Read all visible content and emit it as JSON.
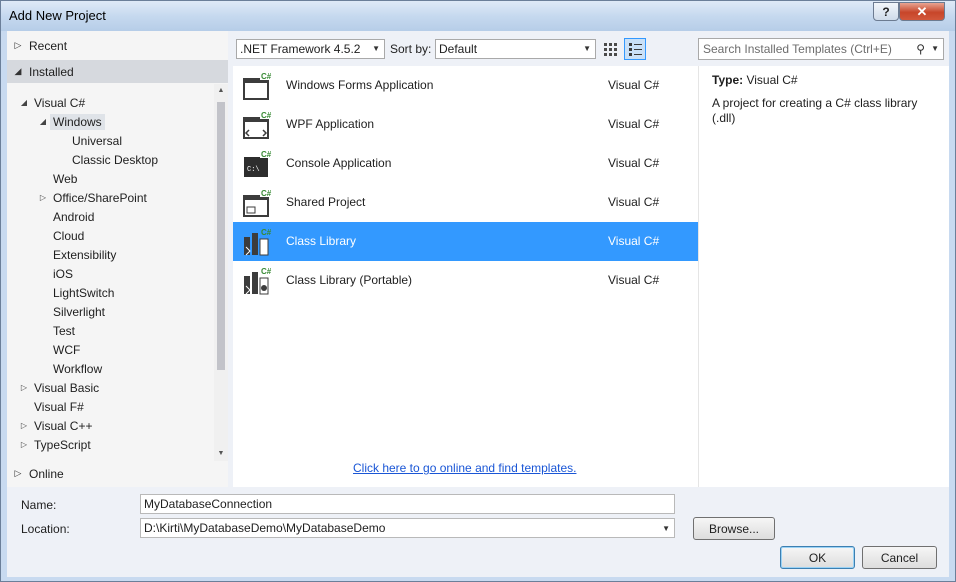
{
  "window": {
    "title": "Add New Project",
    "help_label": "?",
    "close_label": "✕"
  },
  "left": {
    "recent": "Recent",
    "installed": "Installed",
    "online": "Online",
    "tree": [
      {
        "label": "Visual C#",
        "arrow": "◢",
        "indent": 0
      },
      {
        "label": "Windows",
        "arrow": "◢",
        "indent": 1,
        "selected": true
      },
      {
        "label": "Universal",
        "arrow": "",
        "indent": 2
      },
      {
        "label": "Classic Desktop",
        "arrow": "",
        "indent": 2
      },
      {
        "label": "Web",
        "arrow": "",
        "indent": 1
      },
      {
        "label": "Office/SharePoint",
        "arrow": "▷",
        "indent": 1
      },
      {
        "label": "Android",
        "arrow": "",
        "indent": 1
      },
      {
        "label": "Cloud",
        "arrow": "",
        "indent": 1
      },
      {
        "label": "Extensibility",
        "arrow": "",
        "indent": 1
      },
      {
        "label": "iOS",
        "arrow": "",
        "indent": 1
      },
      {
        "label": "LightSwitch",
        "arrow": "",
        "indent": 1
      },
      {
        "label": "Silverlight",
        "arrow": "",
        "indent": 1
      },
      {
        "label": "Test",
        "arrow": "",
        "indent": 1
      },
      {
        "label": "WCF",
        "arrow": "",
        "indent": 1
      },
      {
        "label": "Workflow",
        "arrow": "",
        "indent": 1
      },
      {
        "label": "Visual Basic",
        "arrow": "▷",
        "indent": 0
      },
      {
        "label": "Visual F#",
        "arrow": "",
        "indent": 0
      },
      {
        "label": "Visual C++",
        "arrow": "▷",
        "indent": 0
      },
      {
        "label": "TypeScript",
        "arrow": "▷",
        "indent": 0
      }
    ]
  },
  "toolbar": {
    "framework": ".NET Framework 4.5.2",
    "sort_label": "Sort by:",
    "sort_value": "Default",
    "search_placeholder": "Search Installed Templates (Ctrl+E)"
  },
  "templates": [
    {
      "name": "Windows Forms Application",
      "lang": "Visual C#",
      "icon": "winforms-icon"
    },
    {
      "name": "WPF Application",
      "lang": "Visual C#",
      "icon": "wpf-icon"
    },
    {
      "name": "Console Application",
      "lang": "Visual C#",
      "icon": "console-icon"
    },
    {
      "name": "Shared Project",
      "lang": "Visual C#",
      "icon": "shared-project-icon"
    },
    {
      "name": "Class Library",
      "lang": "Visual C#",
      "icon": "class-library-icon",
      "selected": true
    },
    {
      "name": "Class Library (Portable)",
      "lang": "Visual C#",
      "icon": "class-library-portable-icon"
    }
  ],
  "online_link": "Click here to go online and find templates.",
  "description": {
    "type_label": "Type:",
    "type_value": "Visual C#",
    "text": "A project for creating a C# class library (.dll)"
  },
  "bottom": {
    "name_label": "Name:",
    "name_value": "MyDatabaseConnection",
    "location_label": "Location:",
    "location_value": "D:\\Kirti\\MyDatabaseDemo\\MyDatabaseDemo",
    "browse_label": "Browse...",
    "ok_label": "OK",
    "cancel_label": "Cancel"
  },
  "colors": {
    "selection": "#3399ff",
    "link": "#1a56d6",
    "chrome": "#eef1f7"
  }
}
